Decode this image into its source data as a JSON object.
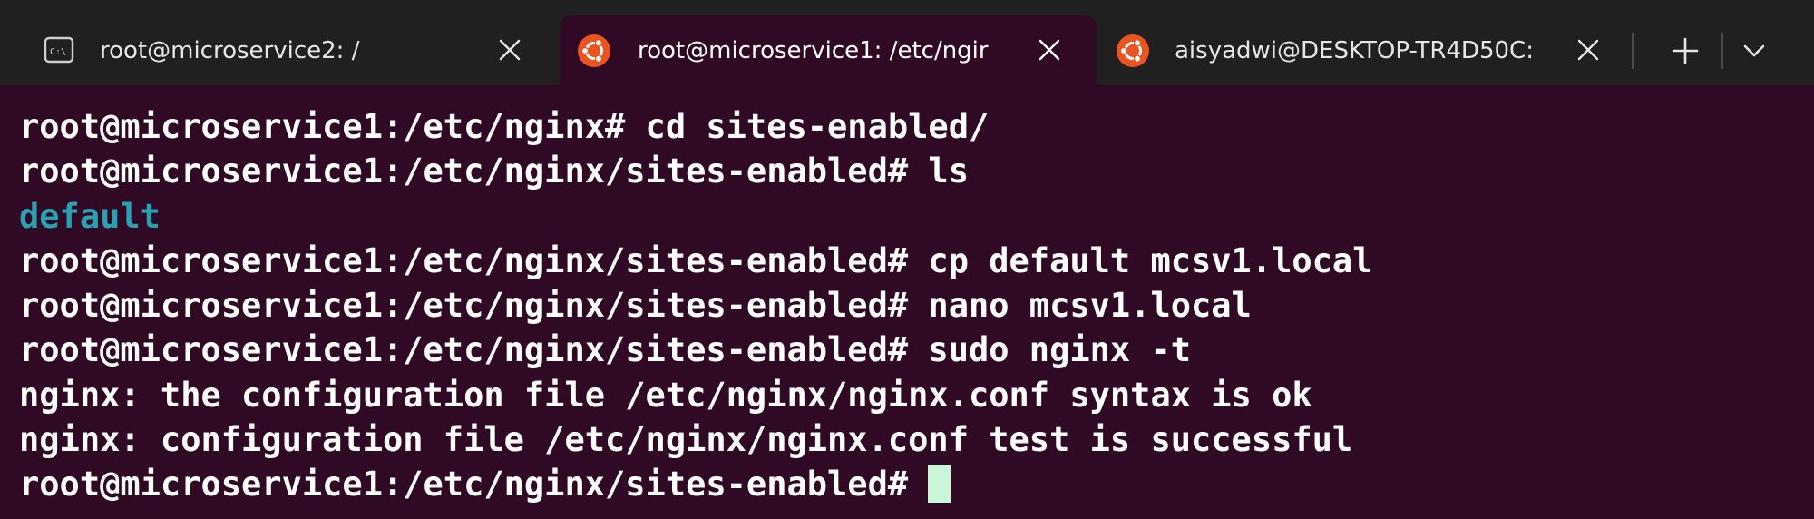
{
  "tabs": [
    {
      "title": "root@microservice2: /",
      "icon": "cmd-icon",
      "active": false
    },
    {
      "title": "root@microservice1: /etc/ngir",
      "icon": "ubuntu-icon",
      "active": true
    },
    {
      "title": "aisyadwi@DESKTOP-TR4D50C:",
      "icon": "ubuntu-icon",
      "active": false
    }
  ],
  "tabbar": {
    "new_tab_icon": "plus-icon",
    "dropdown_icon": "chevron-down-icon"
  },
  "terminal": {
    "lines": [
      "root@microservice1:/etc/nginx# cd sites-enabled/",
      "root@microservice1:/etc/nginx/sites-enabled# ls",
      "default",
      "root@microservice1:/etc/nginx/sites-enabled# cp default mcsv1.local",
      "root@microservice1:/etc/nginx/sites-enabled# nano mcsv1.local",
      "root@microservice1:/etc/nginx/sites-enabled# sudo nginx -t",
      "nginx: the configuration file /etc/nginx/nginx.conf syntax is ok",
      "nginx: configuration file /etc/nginx/nginx.conf test is successful",
      "root@microservice1:/etc/nginx/sites-enabled# "
    ]
  },
  "colors": {
    "terminal_bg": "#300a24",
    "tabbar_bg": "#202020",
    "ubuntu_orange": "#e95420",
    "directory_text": "#2aa1b3",
    "cursor": "#c9f5d9"
  }
}
